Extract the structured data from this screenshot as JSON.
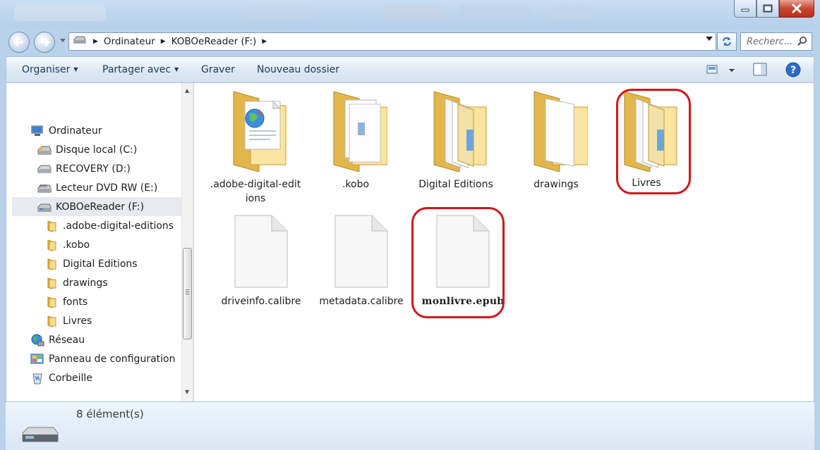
{
  "window": {
    "buttons": {
      "minimize": "minimize",
      "maximize": "maximize",
      "close": "close"
    }
  },
  "address": {
    "segments": [
      "Ordinateur",
      "KOBOeReader (F:)"
    ],
    "search_placeholder": "Recherc..."
  },
  "toolbar": {
    "organize": "Organiser",
    "share": "Partager avec",
    "burn": "Graver",
    "new_folder": "Nouveau dossier"
  },
  "sidebar": {
    "computer": "Ordinateur",
    "drives": [
      "Disque local (C:)",
      "RECOVERY (D:)",
      "Lecteur DVD RW (E:)",
      "KOBOeReader (F:)"
    ],
    "folders": [
      ".adobe-digital-editions",
      ".kobo",
      "Digital Editions",
      "drawings",
      "fonts",
      "Livres"
    ],
    "network": "Réseau",
    "control_panel": "Panneau de configuration",
    "recycle_bin": "Corbeille"
  },
  "files": [
    {
      "name": ".adobe-digital-editions",
      "type": "folder"
    },
    {
      "name": ".kobo",
      "type": "folder"
    },
    {
      "name": "Digital Editions",
      "type": "folder"
    },
    {
      "name": "drawings",
      "type": "folder"
    },
    {
      "name": "Livres",
      "type": "folder",
      "highlighted": true
    },
    {
      "name": "driveinfo.calibre",
      "type": "file"
    },
    {
      "name": "metadata.calibre",
      "type": "file"
    },
    {
      "name": "monlivre.epub",
      "type": "file",
      "highlighted": true
    }
  ],
  "status": {
    "count": "8 élément(s)"
  },
  "colors": {
    "highlight": "#d4141c",
    "folder": "#f3d27a",
    "accent": "#1e395b"
  }
}
